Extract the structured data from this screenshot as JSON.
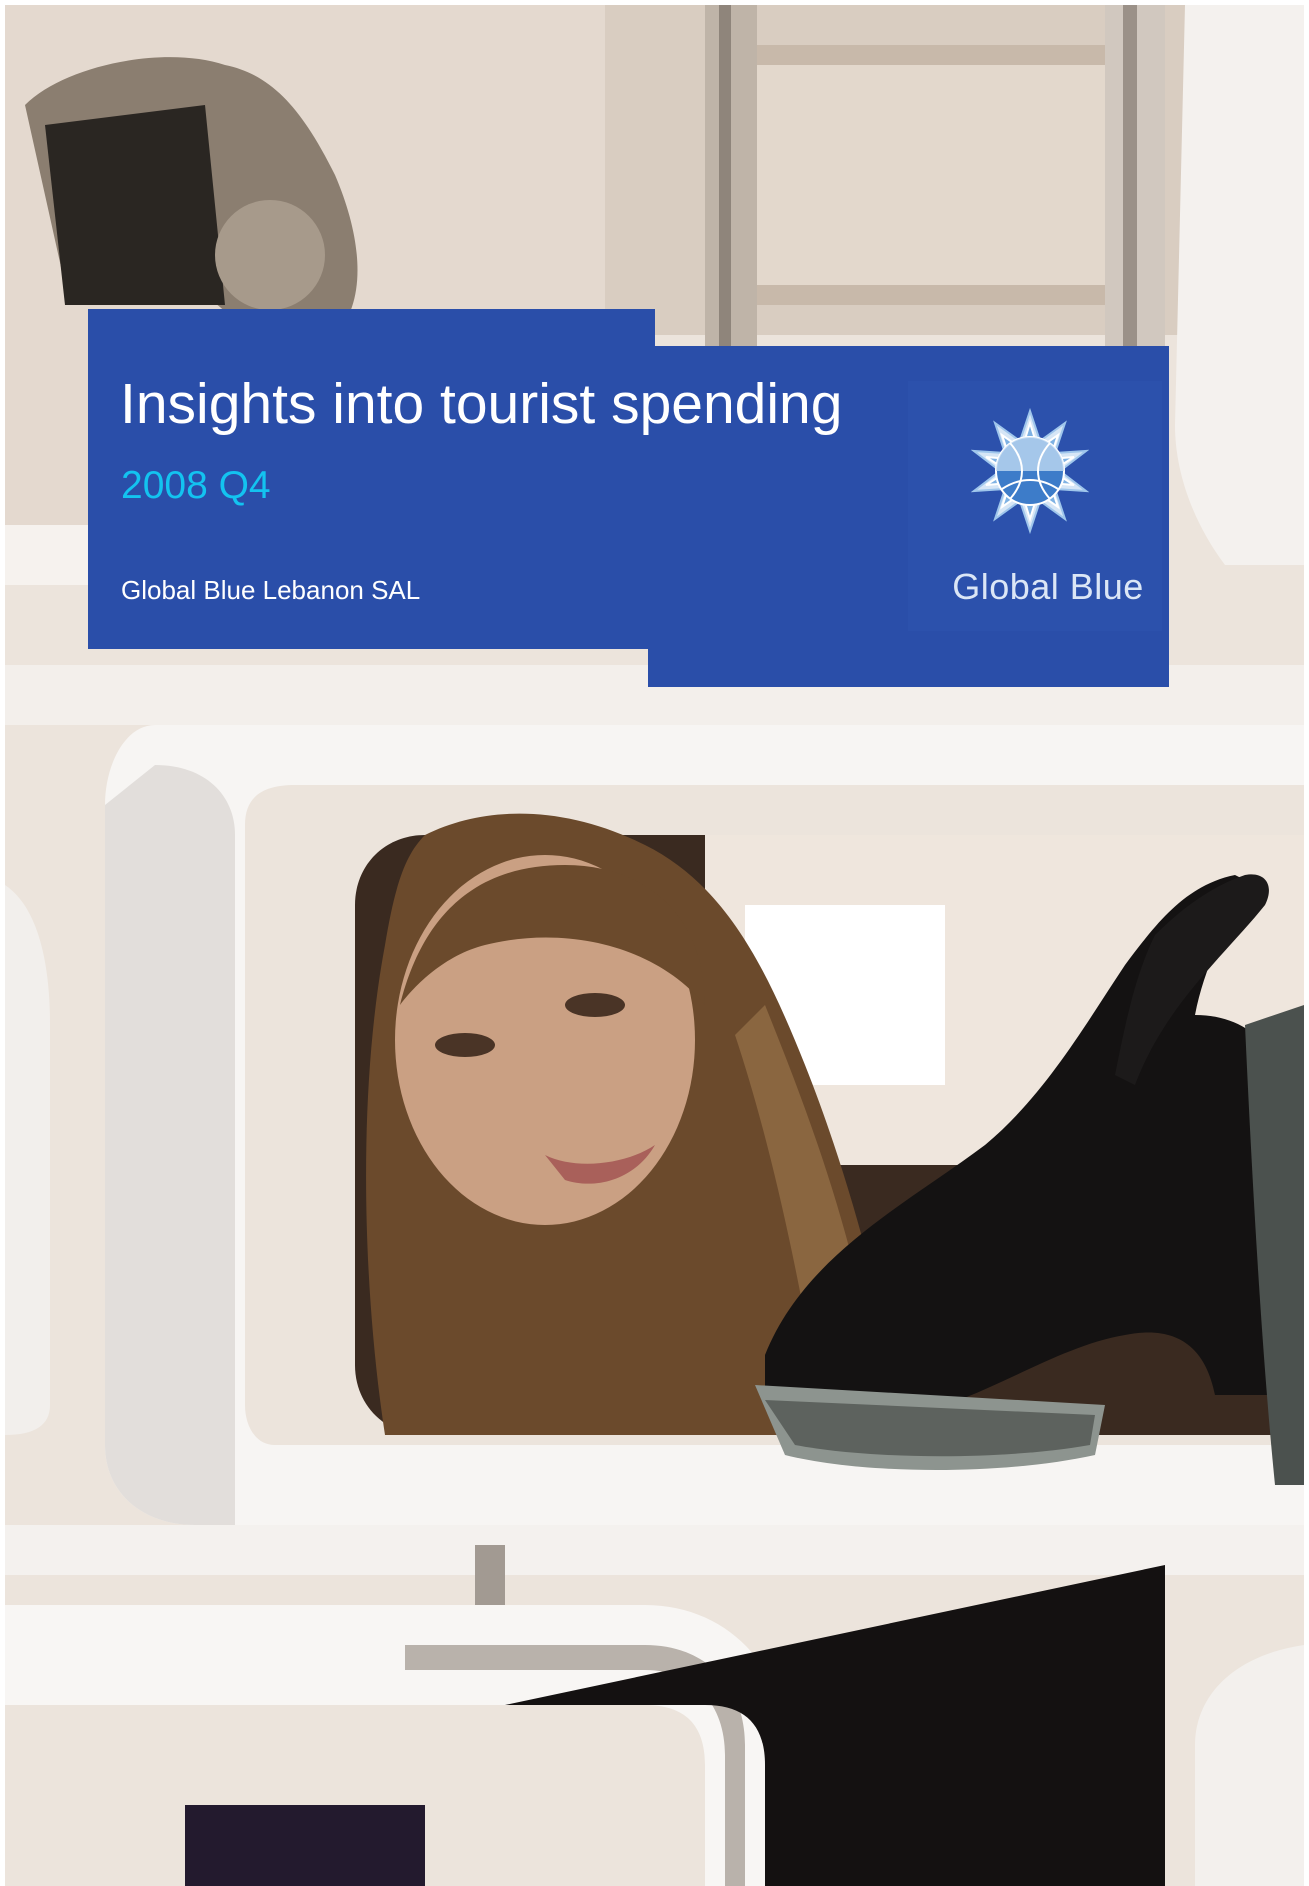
{
  "cover": {
    "title": "Insights into tourist spending",
    "period": "2008 Q4",
    "company": "Global Blue Lebanon SAL"
  },
  "logo": {
    "icon": "global-blue-star-globe-icon",
    "wordmark": "Global Blue"
  },
  "photo": {
    "subject": "shopper-looking-at-shoe-icon"
  },
  "colors": {
    "panel_blue": "#2a4ea9",
    "period_cyan": "#13c3f0",
    "text_white": "#ffffff"
  }
}
